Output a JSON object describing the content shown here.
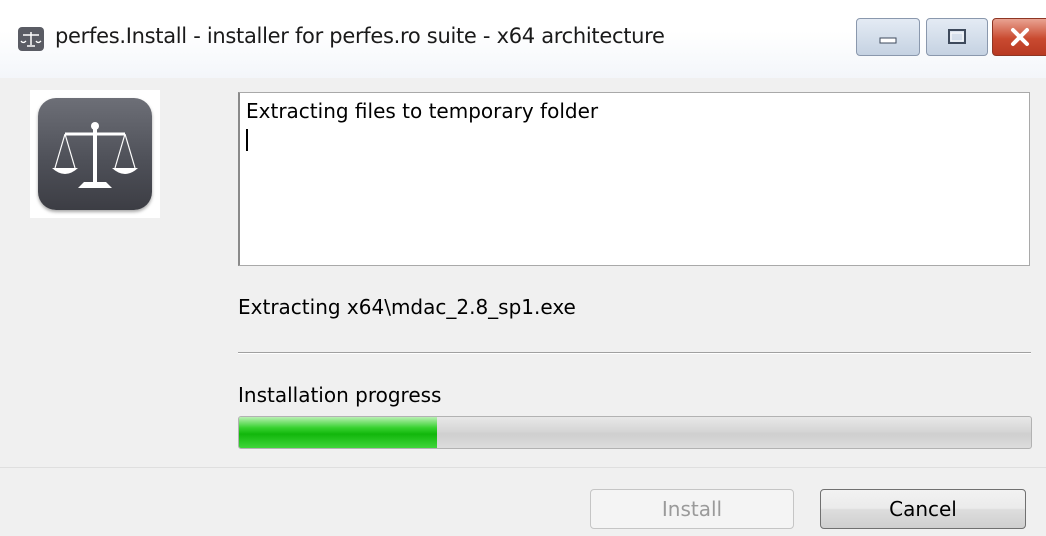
{
  "window": {
    "title": "perfes.Install - installer for perfes.ro suite - x64 architecture",
    "icon": "scales-icon"
  },
  "log": {
    "text": "Extracting files to temporary folder"
  },
  "status": {
    "text": "Extracting x64\\mdac_2.8_sp1.exe"
  },
  "progress": {
    "label": "Installation progress",
    "value_percent": 25
  },
  "buttons": {
    "install_label": "Install",
    "cancel_label": "Cancel"
  },
  "colors": {
    "progress_green": "#12b70c",
    "close_red": "#c94a30"
  }
}
